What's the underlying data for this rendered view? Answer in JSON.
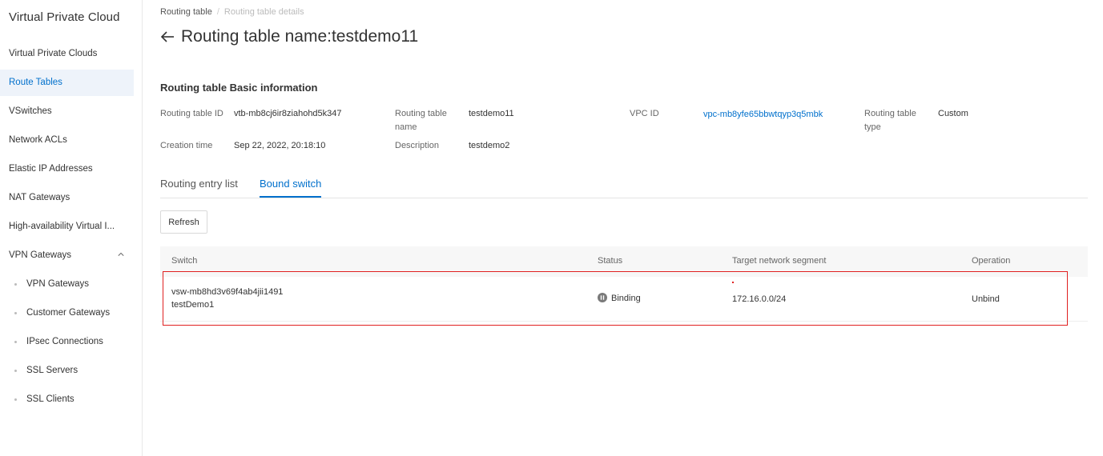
{
  "sidebar": {
    "title": "Virtual Private Cloud",
    "items": [
      {
        "label": "Virtual Private Clouds"
      },
      {
        "label": "Route Tables"
      },
      {
        "label": "VSwitches"
      },
      {
        "label": "Network ACLs"
      },
      {
        "label": "Elastic IP Addresses"
      },
      {
        "label": "NAT Gateways"
      },
      {
        "label": "High-availability Virtual I..."
      },
      {
        "label": "VPN Gateways"
      }
    ],
    "active_item": "Route Tables",
    "sub_items": [
      {
        "label": "VPN Gateways"
      },
      {
        "label": "Customer Gateways"
      },
      {
        "label": "IPsec Connections"
      },
      {
        "label": "SSL Servers"
      },
      {
        "label": "SSL Clients"
      }
    ]
  },
  "breadcrumb": {
    "parent": "Routing table",
    "separator": "/",
    "current": "Routing table details"
  },
  "page_title": "Routing table name:testdemo11",
  "basic_info": {
    "section_title": "Routing table Basic information",
    "fields": [
      {
        "label": "Routing table ID",
        "value": "vtb-mb8cj6ir8ziahohd5k347"
      },
      {
        "label_line1": "Routing table",
        "label_line2": "name",
        "value": "testdemo11"
      },
      {
        "label": "VPC ID",
        "value": "vpc-mb8yfe65bbwtqyp3q5mbk"
      },
      {
        "label_line1": "Routing table",
        "label_line2": "type",
        "value": "Custom"
      },
      {
        "label": "Creation time",
        "value": "Sep 22, 2022, 20:18:10"
      },
      {
        "label": "Description",
        "value": "testdemo2"
      }
    ]
  },
  "tabs": [
    {
      "label": "Routing entry list"
    },
    {
      "label": "Bound switch"
    }
  ],
  "active_tab": "Bound switch",
  "toolbar": {
    "refresh_label": "Refresh"
  },
  "table": {
    "headers": [
      "Switch",
      "Status",
      "Target network segment",
      "Operation"
    ],
    "rows": [
      {
        "switch_id": "vsw-mb8hd3v69f4ab4jii1491",
        "switch_name": "testDemo1",
        "status": "Binding",
        "target_segment": "172.16.0.0/24",
        "operation": "Unbind"
      }
    ]
  },
  "colors": {
    "accent": "#0070cc",
    "highlight": "#e02020",
    "active_nav_bg": "#eef3fa"
  },
  "icons": {
    "back": "arrow-left-icon",
    "vpn_toggle": "chevron-up-icon",
    "status": "pause-circle-icon"
  }
}
